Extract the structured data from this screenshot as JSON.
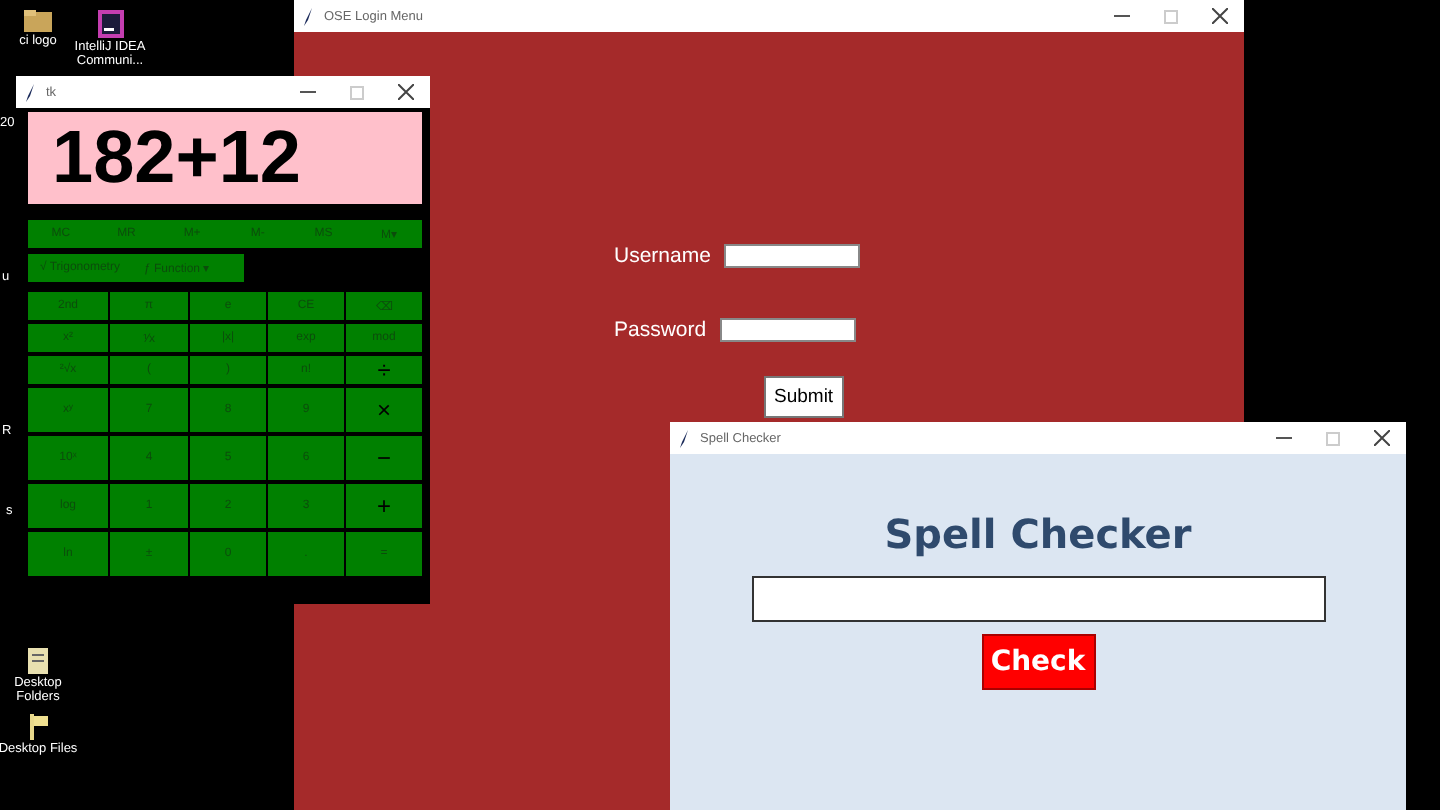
{
  "desktop_icons": [
    {
      "label": "ci logo",
      "kind": "folder"
    },
    {
      "label": "IntelliJ IDEA Communi...",
      "kind": "ide"
    },
    {
      "label": "Desktop Folders",
      "kind": "document"
    },
    {
      "label": "Desktop Files",
      "kind": "flag"
    }
  ],
  "partial_labels": [
    "20",
    "u",
    "R",
    "s"
  ],
  "login_window": {
    "title": "OSE Login Menu",
    "username_label": "Username",
    "password_label": "Password",
    "submit_button": "Submit"
  },
  "calculator_window": {
    "title": "tk",
    "display": "182+12",
    "memory_buttons": [
      "MC",
      "MR",
      "M+",
      "M-",
      "MS",
      "M▾"
    ],
    "tabs": [
      "√ Trigonometry",
      "ƒ Function ▾"
    ],
    "keys": [
      [
        "2nd",
        "π",
        "e",
        "CE",
        "⌫"
      ],
      [
        "x²",
        "⅟x",
        "|x|",
        "exp",
        "mod"
      ],
      [
        "²√x",
        "(",
        ")",
        "n!",
        "÷"
      ],
      [
        "xʸ",
        "7",
        "8",
        "9",
        "×"
      ],
      [
        "10ˣ",
        "4",
        "5",
        "6",
        "−"
      ],
      [
        "log",
        "1",
        "2",
        "3",
        "+"
      ],
      [
        "ln",
        "±",
        "0",
        ".",
        "="
      ]
    ]
  },
  "spell_window": {
    "title": "Spell Checker",
    "heading": "Spell Checker",
    "check_button": "Check"
  }
}
